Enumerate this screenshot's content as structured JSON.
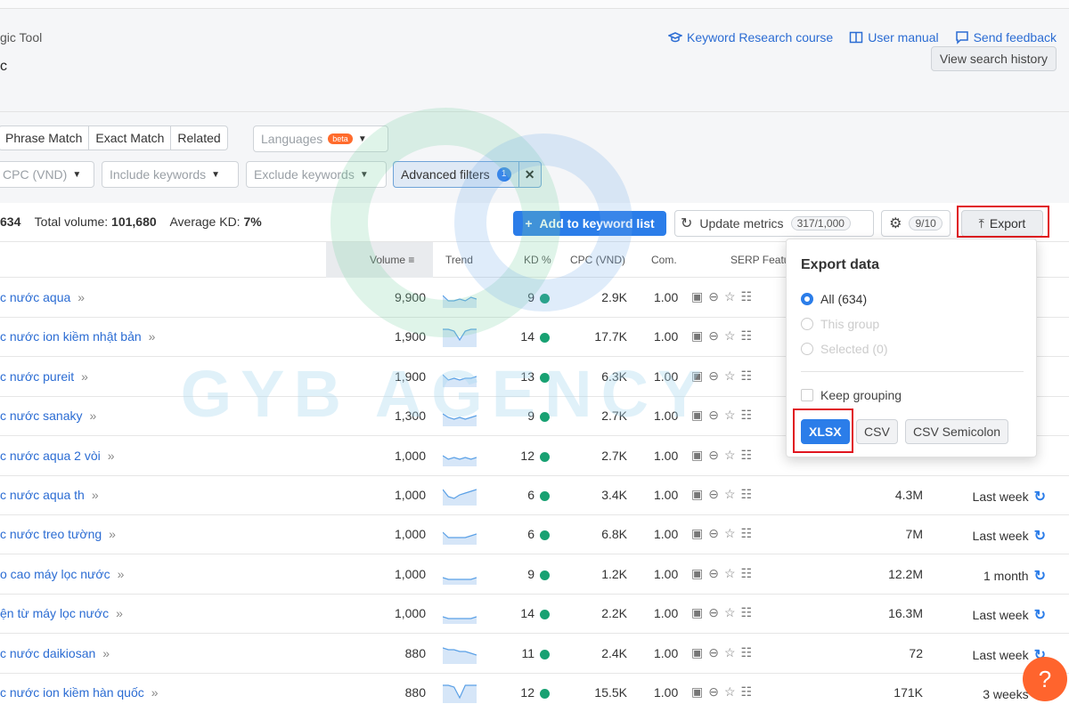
{
  "header": {
    "breadcrumb": "gic Tool",
    "title_fragment": "c",
    "links": [
      {
        "label": "Keyword Research course",
        "icon": "graduation-cap-icon"
      },
      {
        "label": "User manual",
        "icon": "book-icon"
      },
      {
        "label": "Send feedback",
        "icon": "feedback-icon"
      }
    ],
    "history_button": "View search history"
  },
  "filters": {
    "match_tabs": [
      "Phrase Match",
      "Exact Match",
      "Related"
    ],
    "languages": "Languages",
    "languages_badge": "beta",
    "cpc": "CPC (VND)",
    "include": "Include keywords",
    "exclude": "Exclude keywords",
    "advanced": "Advanced filters",
    "advanced_count": "1"
  },
  "stats": {
    "count": "634",
    "total_volume_label": "Total volume:",
    "total_volume": "101,680",
    "avg_kd_label": "Average KD:",
    "avg_kd": "7%",
    "add_button": "Add to keyword list",
    "update_button": "Update metrics",
    "update_count": "317/1,000",
    "settings_count": "9/10",
    "export_button": "Export"
  },
  "table": {
    "headers": {
      "volume": "Volume",
      "trend": "Trend",
      "kd": "KD %",
      "cpc": "CPC (VND)",
      "com": "Com.",
      "serp": "SERP Featu"
    },
    "rows": [
      {
        "keyword": "c nước aqua",
        "volume": "9,900",
        "kd": "9",
        "cpc": "2.9K",
        "com": "1.00",
        "results": "",
        "updated": "",
        "trend": [
          6,
          3,
          3,
          4,
          3,
          5,
          4
        ]
      },
      {
        "keyword": "c nước ion kiềm nhật bản",
        "volume": "1,900",
        "kd": "14",
        "cpc": "17.7K",
        "com": "1.00",
        "results": "",
        "updated": "",
        "trend": [
          9,
          9,
          8,
          3,
          8,
          9,
          9
        ]
      },
      {
        "keyword": "c nước pureit",
        "volume": "1,900",
        "kd": "13",
        "cpc": "6.3K",
        "com": "1.00",
        "results": "",
        "updated": "",
        "trend": [
          6,
          3,
          4,
          3,
          4,
          4,
          5
        ]
      },
      {
        "keyword": "c nước sanaky",
        "volume": "1,300",
        "kd": "9",
        "cpc": "2.7K",
        "com": "1.00",
        "results": "",
        "updated": "",
        "trend": [
          6,
          4,
          3,
          4,
          3,
          4,
          5
        ]
      },
      {
        "keyword": "c nước aqua 2 vòi",
        "volume": "1,000",
        "kd": "12",
        "cpc": "2.7K",
        "com": "1.00",
        "results": "",
        "updated": "",
        "trend": [
          5,
          3,
          4,
          3,
          4,
          3,
          4
        ]
      },
      {
        "keyword": "c nước aqua th",
        "volume": "1,000",
        "kd": "6",
        "cpc": "3.4K",
        "com": "1.00",
        "results": "4.3M",
        "updated": "Last week",
        "trend": [
          8,
          4,
          3,
          5,
          6,
          7,
          8
        ]
      },
      {
        "keyword": "c nước treo tường",
        "volume": "1,000",
        "kd": "6",
        "cpc": "6.8K",
        "com": "1.00",
        "results": "7M",
        "updated": "Last week",
        "trend": [
          6,
          3,
          3,
          3,
          3,
          4,
          5
        ]
      },
      {
        "keyword": "o cao máy lọc nước",
        "volume": "1,000",
        "kd": "9",
        "cpc": "1.2K",
        "com": "1.00",
        "results": "12.2M",
        "updated": "1 month",
        "trend": [
          3,
          2,
          2,
          2,
          2,
          2,
          3
        ]
      },
      {
        "keyword": "ện từ máy lọc nước",
        "volume": "1,000",
        "kd": "14",
        "cpc": "2.2K",
        "com": "1.00",
        "results": "16.3M",
        "updated": "Last week",
        "trend": [
          3,
          2,
          2,
          2,
          2,
          2,
          3
        ]
      },
      {
        "keyword": "c nước daikiosan",
        "volume": "880",
        "kd": "11",
        "cpc": "2.4K",
        "com": "1.00",
        "results": "72",
        "updated": "Last week",
        "trend": [
          8,
          7,
          7,
          6,
          6,
          5,
          4
        ]
      },
      {
        "keyword": "c nước ion kiềm hàn quốc",
        "volume": "880",
        "kd": "12",
        "cpc": "15.5K",
        "com": "1.00",
        "results": "171K",
        "updated": "3 weeks",
        "trend": [
          9,
          9,
          8,
          2,
          9,
          9,
          9
        ]
      }
    ]
  },
  "export_panel": {
    "title": "Export data",
    "options": [
      {
        "label": "All (634)",
        "selected": true,
        "disabled": false
      },
      {
        "label": "This group",
        "selected": false,
        "disabled": true
      },
      {
        "label": "Selected (0)",
        "selected": false,
        "disabled": true
      }
    ],
    "keep_grouping": "Keep grouping",
    "formats": [
      "XLSX",
      "CSV",
      "CSV Semicolon"
    ]
  },
  "watermark": "GYB AGENCY",
  "help": "?",
  "colors": {
    "accent": "#2b7de9",
    "kd_dot": "#18a172",
    "highlight": "#e0141e",
    "help": "#ff642d"
  }
}
